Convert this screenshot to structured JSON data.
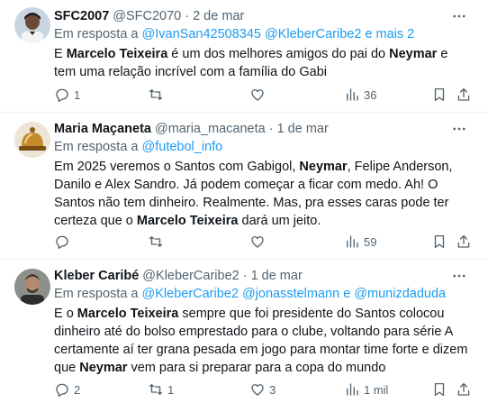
{
  "tweets": [
    {
      "name": "SFC2007",
      "handle": "@SFC2070",
      "date": "2 de mar",
      "reply_prefix": "Em resposta a ",
      "reply_mentions": "@IvanSan42508345 @KleberCaribe2 e mais 2",
      "body": [
        {
          "t": "E ",
          "b": false
        },
        {
          "t": "Marcelo Teixeira",
          "b": true
        },
        {
          "t": " é um dos melhores amigos do pai do ",
          "b": false
        },
        {
          "t": "Neymar",
          "b": true
        },
        {
          "t": " e tem uma relação incrível com a família do Gabi",
          "b": false
        }
      ],
      "replies": "1",
      "retweets": "",
      "likes": "",
      "views": "36"
    },
    {
      "name": "Maria Maçaneta",
      "handle": "@maria_macaneta",
      "date": "1 de mar",
      "reply_prefix": "Em resposta a ",
      "reply_mentions": "@futebol_info",
      "body": [
        {
          "t": "Em 2025 veremos o Santos com Gabigol, ",
          "b": false
        },
        {
          "t": "Neymar",
          "b": true
        },
        {
          "t": ", Felipe Anderson, Danilo e Alex Sandro. Já podem começar a ficar com medo. Ah! O Santos não tem dinheiro. Realmente. Mas, pra esses caras pode ter certeza que o ",
          "b": false
        },
        {
          "t": "Marcelo Teixeira",
          "b": true
        },
        {
          "t": " dará um jeito.",
          "b": false
        }
      ],
      "replies": "",
      "retweets": "",
      "likes": "",
      "views": "59"
    },
    {
      "name": "Kleber Caribé",
      "handle": "@KleberCaribe2",
      "date": "1 de mar",
      "reply_prefix": "Em resposta a ",
      "reply_mentions": "@KleberCaribe2 @jonasstelmann e @munizdaduda",
      "body": [
        {
          "t": "E o ",
          "b": false
        },
        {
          "t": "Marcelo Teixeira",
          "b": true
        },
        {
          "t": " sempre que foi presidente do Santos colocou dinheiro até do bolso emprestado para o clube, voltando para série A certamente aí ter grana pesada em jogo para montar time forte e dizem que ",
          "b": false
        },
        {
          "t": "Neymar",
          "b": true
        },
        {
          "t": " vem para si preparar para a copa do mundo",
          "b": false
        }
      ],
      "replies": "2",
      "retweets": "1",
      "likes": "3",
      "views": "1 mil"
    }
  ],
  "icons": {
    "more": "more-horizontal-icon",
    "reply": "reply-bubble-icon",
    "retweet": "retweet-icon",
    "like": "heart-icon",
    "views": "views-bar-chart-icon",
    "bookmark": "bookmark-icon",
    "share": "share-icon"
  },
  "colors": {
    "link": "#1d9bf0",
    "secondary": "#536471",
    "text": "#0f1419",
    "divider": "#eff3f4"
  }
}
